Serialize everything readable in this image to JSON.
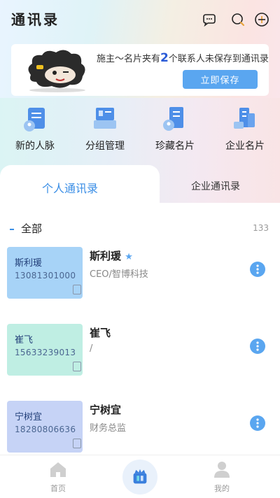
{
  "app": {
    "title": "通讯录"
  },
  "banner": {
    "text_before": "施主～名片夹有",
    "count": "2",
    "text_after": "个联系人未保存到通讯录",
    "button": "立即保存"
  },
  "quick_actions": [
    {
      "label": "新的人脉",
      "icon": "new-contacts-icon"
    },
    {
      "label": "分组管理",
      "icon": "group-management-icon"
    },
    {
      "label": "珍藏名片",
      "icon": "favorite-cards-icon"
    },
    {
      "label": "企业名片",
      "icon": "company-cards-icon"
    }
  ],
  "tabs": [
    {
      "label": "个人通讯录",
      "active": true
    },
    {
      "label": "企业通讯录",
      "active": false
    }
  ],
  "section": {
    "label": "全部",
    "count": "133"
  },
  "contacts": [
    {
      "name": "斯利瑗",
      "phone": "13081301000",
      "title": "CEO/智博科技",
      "card_color": "#a7d3f7",
      "vip": true
    },
    {
      "name": "崔飞",
      "phone": "15633239013",
      "title": "/",
      "card_color": "#bfeee3",
      "vip": false
    },
    {
      "name": "宁树宜",
      "phone": "18280806636",
      "title": "财务总监",
      "card_color": "#c6d3f6",
      "vip": false
    }
  ],
  "nav": [
    {
      "label": "首页",
      "icon": "home-icon"
    },
    {
      "label": "",
      "icon": "center-app-icon"
    },
    {
      "label": "我的",
      "icon": "profile-icon"
    }
  ],
  "colors": {
    "accent": "#3a8ee6",
    "button": "#5aa6f0"
  }
}
